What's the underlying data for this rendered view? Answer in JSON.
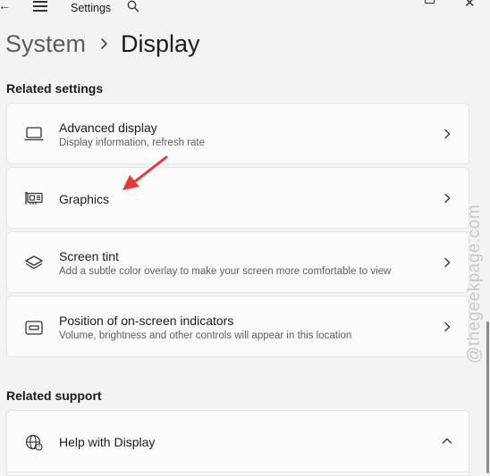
{
  "window": {
    "app_title": "Settings",
    "icons": [
      "back-arrow-icon",
      "hamburger-menu-icon",
      "search-icon",
      "maximize-icon",
      "close-icon"
    ]
  },
  "breadcrumb": {
    "parent": "System",
    "current": "Display"
  },
  "related_settings": {
    "title": "Related settings",
    "items": [
      {
        "label": "Advanced display",
        "description": "Display information, refresh rate",
        "icon": "monitor-icon"
      },
      {
        "label": "Graphics",
        "description": "",
        "icon": "graphics-card-icon"
      },
      {
        "label": "Screen tint",
        "description": "Add a subtle color overlay to make your screen more comfortable to view",
        "icon": "layers-icon"
      },
      {
        "label": "Position of on-screen indicators",
        "description": "Volume, brightness and other controls will appear in this location",
        "icon": "on-screen-indicator-icon"
      }
    ]
  },
  "related_support": {
    "title": "Related support",
    "items": [
      {
        "label": "Help with Display",
        "icon": "globe-help-icon",
        "expanded": true
      }
    ]
  },
  "annotation": {
    "color": "#e53935"
  },
  "watermark": {
    "text": "@thegeekpage.com"
  },
  "colors": {
    "background": "#f3f3f3",
    "card": "#fbfbfb",
    "card_border": "#e5e5e5"
  }
}
